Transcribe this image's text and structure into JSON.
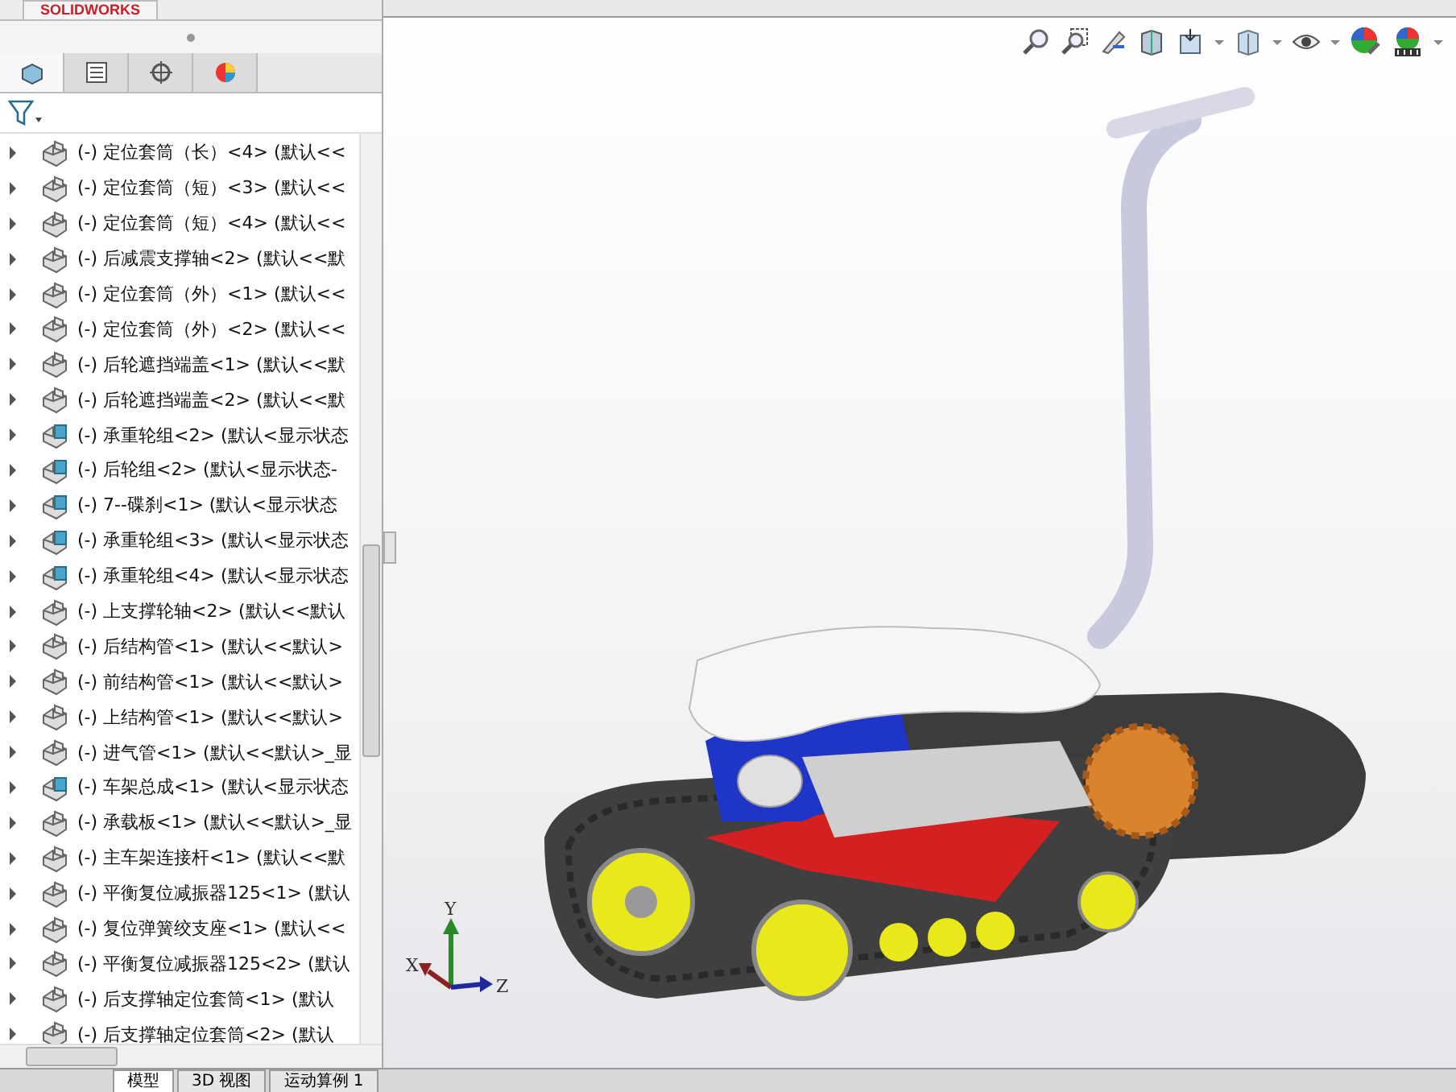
{
  "app_logo": {
    "text": "SOLIDWORKS"
  },
  "panel_tabs": [
    {
      "kind": "tree",
      "selected": true
    },
    {
      "kind": "property",
      "selected": false
    },
    {
      "kind": "config",
      "selected": false
    },
    {
      "kind": "display",
      "selected": false
    }
  ],
  "tree": {
    "items": [
      {
        "kind": "part",
        "label": "(-) 定位套筒（长）<4> (默认<<"
      },
      {
        "kind": "part",
        "label": "(-) 定位套筒（短）<3> (默认<<"
      },
      {
        "kind": "part",
        "label": "(-) 定位套筒（短）<4> (默认<<"
      },
      {
        "kind": "part",
        "label": "(-) 后减震支撑轴<2> (默认<<默"
      },
      {
        "kind": "part",
        "label": "(-) 定位套筒（外）<1> (默认<<"
      },
      {
        "kind": "part",
        "label": "(-) 定位套筒（外）<2> (默认<<"
      },
      {
        "kind": "part",
        "label": "(-) 后轮遮挡端盖<1> (默认<<默"
      },
      {
        "kind": "part",
        "label": "(-) 后轮遮挡端盖<2> (默认<<默"
      },
      {
        "kind": "assembly",
        "label": "(-) 承重轮组<2> (默认<显示状态"
      },
      {
        "kind": "assembly",
        "label": "(-) 后轮组<2> (默认<显示状态-"
      },
      {
        "kind": "assembly",
        "label": "(-) 7--碟刹<1> (默认<显示状态"
      },
      {
        "kind": "assembly",
        "label": "(-) 承重轮组<3> (默认<显示状态"
      },
      {
        "kind": "assembly",
        "label": "(-) 承重轮组<4> (默认<显示状态"
      },
      {
        "kind": "part",
        "label": "(-) 上支撑轮轴<2> (默认<<默认"
      },
      {
        "kind": "part",
        "label": "(-) 后结构管<1> (默认<<默认>"
      },
      {
        "kind": "part",
        "label": "(-) 前结构管<1> (默认<<默认>"
      },
      {
        "kind": "part",
        "label": "(-) 上结构管<1> (默认<<默认>"
      },
      {
        "kind": "part",
        "label": "(-) 进气管<1> (默认<<默认>_显"
      },
      {
        "kind": "assembly",
        "label": "(-) 车架总成<1> (默认<显示状态"
      },
      {
        "kind": "part",
        "label": "(-) 承载板<1> (默认<<默认>_显"
      },
      {
        "kind": "part",
        "label": "(-) 主车架连接杆<1> (默认<<默"
      },
      {
        "kind": "part",
        "label": "(-) 平衡复位减振器125<1> (默认"
      },
      {
        "kind": "part",
        "label": "(-) 复位弹簧绞支座<1> (默认<<"
      },
      {
        "kind": "part",
        "label": "(-) 平衡复位减振器125<2> (默认"
      },
      {
        "kind": "part",
        "label": "(-) 后支撑轴定位套筒<1> (默认"
      },
      {
        "kind": "part",
        "label": "(-) 后支撑轴定位套筒<2> (默认"
      }
    ]
  },
  "bottom_tabs": [
    {
      "label": "模型",
      "selected": true
    },
    {
      "label": "3D 视图",
      "selected": false
    },
    {
      "label": "运动算例 1",
      "selected": false
    }
  ],
  "triad": {
    "labels": [
      "X",
      "Y",
      "Z"
    ]
  }
}
